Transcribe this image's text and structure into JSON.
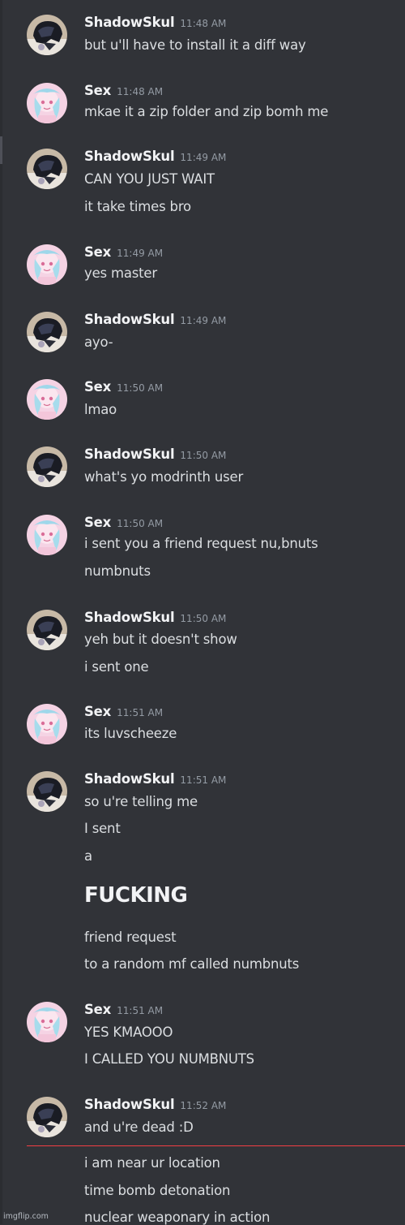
{
  "channel": {
    "users": {
      "shadow": {
        "name": "ShadowSkul",
        "avatar_icon": "dark-hooded-figure-avatar-icon"
      },
      "sex": {
        "name": "Sex",
        "avatar_icon": "pink-anime-girl-avatar-icon"
      }
    },
    "messages": [
      {
        "user": "ShadowSkul",
        "time": "11:48 AM",
        "lines": [
          "but u'll have to install it a diff way"
        ]
      },
      {
        "user": "Sex",
        "time": "11:48 AM",
        "lines": [
          "mkae it a zip folder and zip bomh me"
        ]
      },
      {
        "user": "ShadowSkul",
        "time": "11:49 AM",
        "lines": [
          "CAN YOU JUST WAIT",
          "it take times bro"
        ]
      },
      {
        "user": "Sex",
        "time": "11:49 AM",
        "lines": [
          "yes master"
        ]
      },
      {
        "user": "ShadowSkul",
        "time": "11:49 AM",
        "lines": [
          "ayo-"
        ]
      },
      {
        "user": "Sex",
        "time": "11:50 AM",
        "lines": [
          "lmao"
        ]
      },
      {
        "user": "ShadowSkul",
        "time": "11:50 AM",
        "lines": [
          "what's yo modrinth user"
        ]
      },
      {
        "user": "Sex",
        "time": "11:50 AM",
        "lines": [
          "i sent you a friend request nu,bnuts",
          "numbnuts"
        ]
      },
      {
        "user": "ShadowSkul",
        "time": "11:50 AM",
        "lines": [
          "yeh but it doesn't show",
          "i sent one"
        ]
      },
      {
        "user": "Sex",
        "time": "11:51 AM",
        "lines": [
          "its luvscheeze"
        ]
      },
      {
        "user": "ShadowSkul",
        "time": "11:51 AM",
        "lines": [
          "so u're telling me",
          "I sent",
          "a",
          "FUCKING",
          "friend request",
          "to a random mf called numbnuts"
        ]
      },
      {
        "user": "Sex",
        "time": "11:51 AM",
        "lines": [
          "YES KMAOOO",
          "I CALLED YOU NUMBNUTS"
        ]
      },
      {
        "user": "ShadowSkul",
        "time": "11:52 AM",
        "lines": [
          "and u're dead :D",
          "i am near ur location",
          "time bomb detonation",
          "nuclear weaponary in action"
        ]
      }
    ]
  },
  "watermark": "imgflip.com",
  "colors": {
    "background": "#313338",
    "username": "#f2f3f5",
    "timestamp": "#949ba4",
    "text": "#dbdee1",
    "new_messages_divider": "#f23f43"
  }
}
